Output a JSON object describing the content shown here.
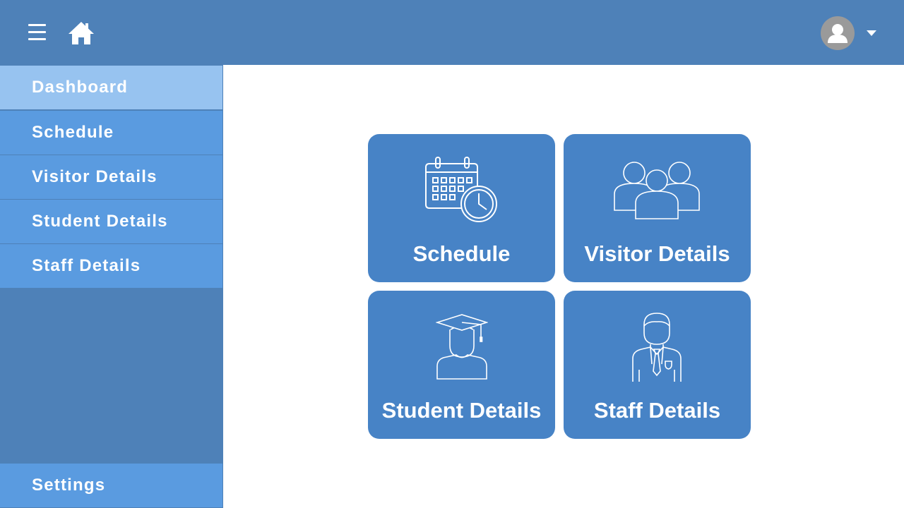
{
  "header": {
    "menu_icon": "hamburger-menu-icon",
    "home_icon": "home-icon",
    "avatar_icon": "user-avatar-icon",
    "dropdown_icon": "caret-down-icon",
    "bar_color": "#4e81b8"
  },
  "sidebar": {
    "items": [
      {
        "label": "Dashboard",
        "active": true
      },
      {
        "label": "Schedule",
        "active": false
      },
      {
        "label": "Visitor Details",
        "active": false
      },
      {
        "label": "Student Details",
        "active": false
      },
      {
        "label": "Staff Details",
        "active": false
      }
    ],
    "settings_label": "Settings",
    "item_color": "#5a9be0",
    "active_color": "#97c3f0"
  },
  "tiles": [
    {
      "label": "Schedule",
      "icon": "calendar-clock-icon"
    },
    {
      "label": "Visitor Details",
      "icon": "group-icon"
    },
    {
      "label": "Student Details",
      "icon": "graduate-icon"
    },
    {
      "label": "Staff Details",
      "icon": "staff-icon"
    }
  ],
  "tile_color": "#4783c6"
}
